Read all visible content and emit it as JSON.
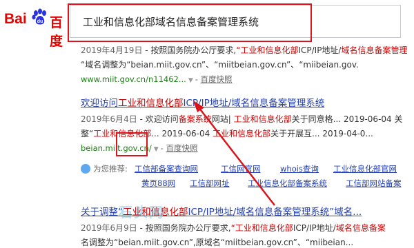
{
  "logo": {
    "text_left": "Bai",
    "text_right": "百度"
  },
  "search": {
    "query": "工业和信息化部域名信息备案管理系统"
  },
  "results": [
    {
      "abstract1": {
        "date": "2019年4月19日",
        "pre": " - 按照国务院办公厅要求,",
        "em": "“工业和信息化部",
        "post": "ICP/IP地址/",
        "em2": "域名信息备案管理",
        "post2": ""
      },
      "abstract2": {
        "pre": "“域名调整为“beian.miit.gov.cn”、“miitbeian.gov.cn”、“miibeian.gov.",
        "em": "",
        "post": ""
      },
      "url": "www.miit.gov.cn/n11462...",
      "snapshot": "百度快照"
    },
    {
      "title": {
        "pre": "欢迎访问",
        "em": "工业和信息化部",
        "post": "ICP/IP地址/",
        "em2": "域名信息备案管理系统"
      },
      "abstract1": {
        "date": "2019年6月4日",
        "pre": " - 欢迎访问",
        "em": "备案系统",
        "post": "网站| ",
        "em2": "工业和信息化部",
        "post2": "关于同意格... 2019-06-04 关"
      },
      "abstract2": {
        "pre": "整“",
        "em": "工业和信息化部",
        "post": "... 2019-06-04 ",
        "em2": "工业和信息化部",
        "post2": "关于开展互... 2019-04-0..."
      },
      "url": "beian.miit.gov.cn/",
      "snapshot": "百度快照"
    },
    {
      "title": {
        "pre": "关于调整“",
        "em": "工业和信息化部",
        "post": "ICP/IP地址/",
        "em2": "域名信息备案管理系统",
        "post2": "”域名..."
      },
      "abstract1": {
        "date": "2019年6月9日",
        "pre": " - 按照国务院办公厅要求,",
        "em": "“工业和信息化部",
        "post": "ICP/IP地址/",
        "em2": "域名信息备案",
        "post2": ""
      },
      "abstract2": {
        "pre": "名调整为“beian.miit.gov.cn”,原域名“miitbeian.gov.cn”、“miibeian..."
      }
    }
  ],
  "recommend": {
    "label": "为您推荐:",
    "links": [
      "工信部备案查询网",
      "工信网官网",
      "whois查询",
      "工业信息化部官网",
      "黄页88网",
      "工信部网址",
      "工业信息化部备案系统",
      "工信部网站备案"
    ]
  },
  "colors": {
    "annotation": "#d9151b",
    "link": "#2440b3",
    "highlight": "#cc0000",
    "url": "#1a7f12"
  },
  "watermark": "石头网"
}
